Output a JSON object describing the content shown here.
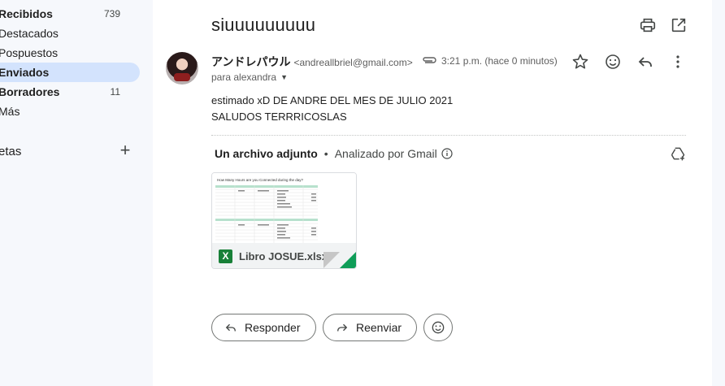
{
  "sidebar": {
    "items": [
      {
        "label": "Recibidos",
        "count": "739"
      },
      {
        "label": "Destacados",
        "count": ""
      },
      {
        "label": "Pospuestos",
        "count": ""
      },
      {
        "label": "Enviados",
        "count": ""
      },
      {
        "label": "Borradores",
        "count": "11"
      },
      {
        "label": "Más",
        "count": ""
      }
    ],
    "labels_title": "etas",
    "labels_add": "+"
  },
  "email": {
    "subject": "siuuuuuuuuu",
    "sender_name": "アンドレパウル",
    "sender_email": "<andreallbriel@gmail.com>",
    "time": "3:21 p.m. (hace 0 minutos)",
    "recipient": "para alexandra",
    "body": [
      "estimado xD DE ANDRE DEL MES DE  JULIO 2021",
      "SALUDOS  TERRRICOSLAS"
    ]
  },
  "attachments": {
    "count_label": "Un archivo adjunto",
    "separator": "•",
    "scan_label": "Analizado por Gmail",
    "file_name": "Libro JOSUE.xlsx",
    "file_badge": "X",
    "thumbnail_title": "How Many Hours are you Connected during the day?"
  },
  "actions": {
    "reply": "Responder",
    "forward": "Reenviar"
  },
  "colors": {
    "active_nav": "#d3e3fd",
    "excel_green": "#188038"
  }
}
